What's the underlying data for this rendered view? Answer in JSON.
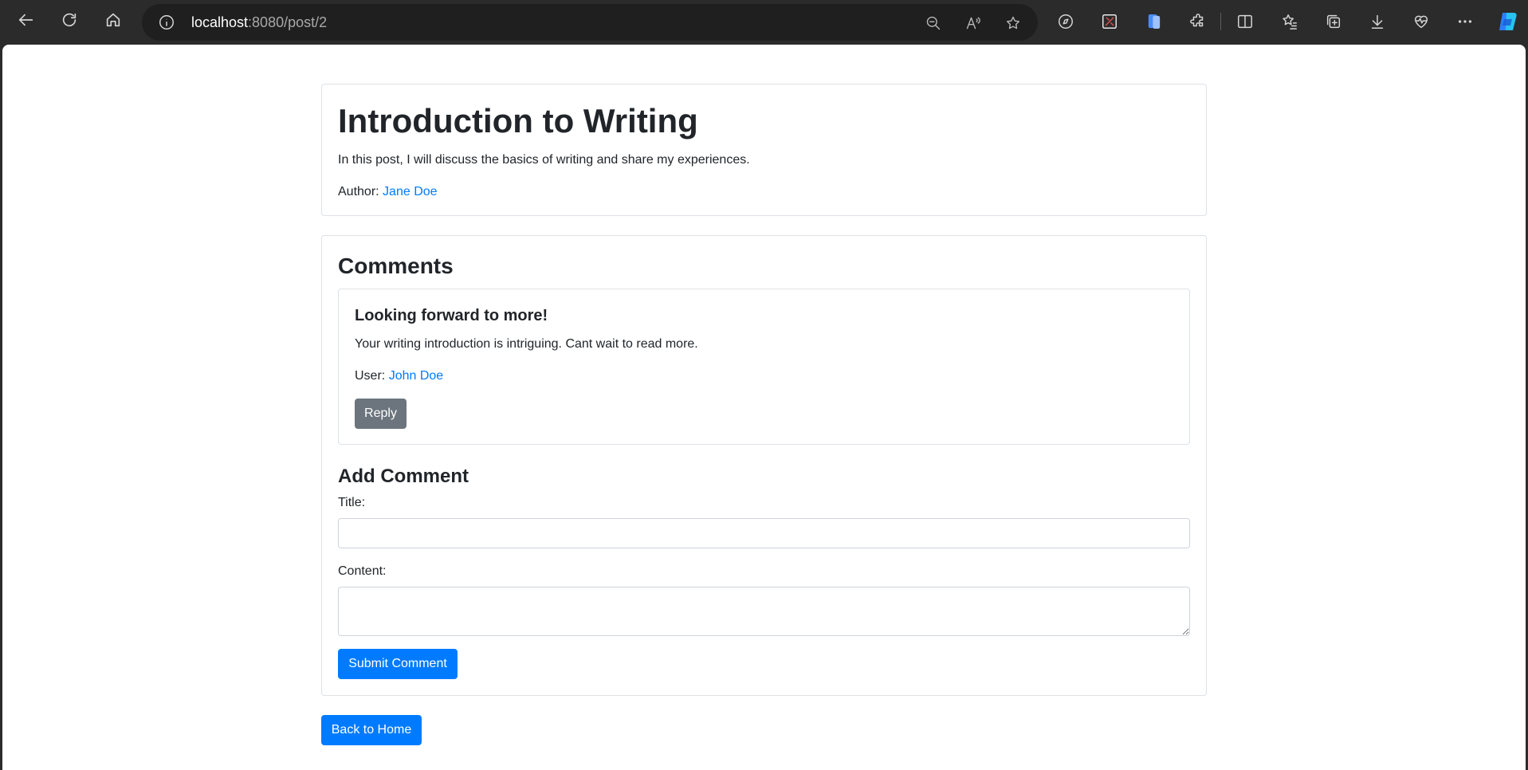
{
  "browser": {
    "url_host": "localhost",
    "url_path": ":8080/post/2"
  },
  "post": {
    "title": "Introduction to Writing",
    "body": "In this post, I will discuss the basics of writing and share my experiences.",
    "author_label": "Author:",
    "author_name": "Jane Doe"
  },
  "comments": {
    "heading": "Comments",
    "items": [
      {
        "title": "Looking forward to more!",
        "content": "Your writing introduction is intriguing. Cant wait to read more.",
        "user_label": "User:",
        "user_name": "John Doe",
        "reply_label": "Reply"
      }
    ]
  },
  "add_comment": {
    "heading": "Add Comment",
    "title_label": "Title:",
    "title_value": "",
    "content_label": "Content:",
    "content_value": "",
    "submit_label": "Submit Comment"
  },
  "back_label": "Back to Home",
  "colors": {
    "primary": "#007bff",
    "secondary": "#6c757d",
    "chrome_bg": "#2b2b2b"
  }
}
